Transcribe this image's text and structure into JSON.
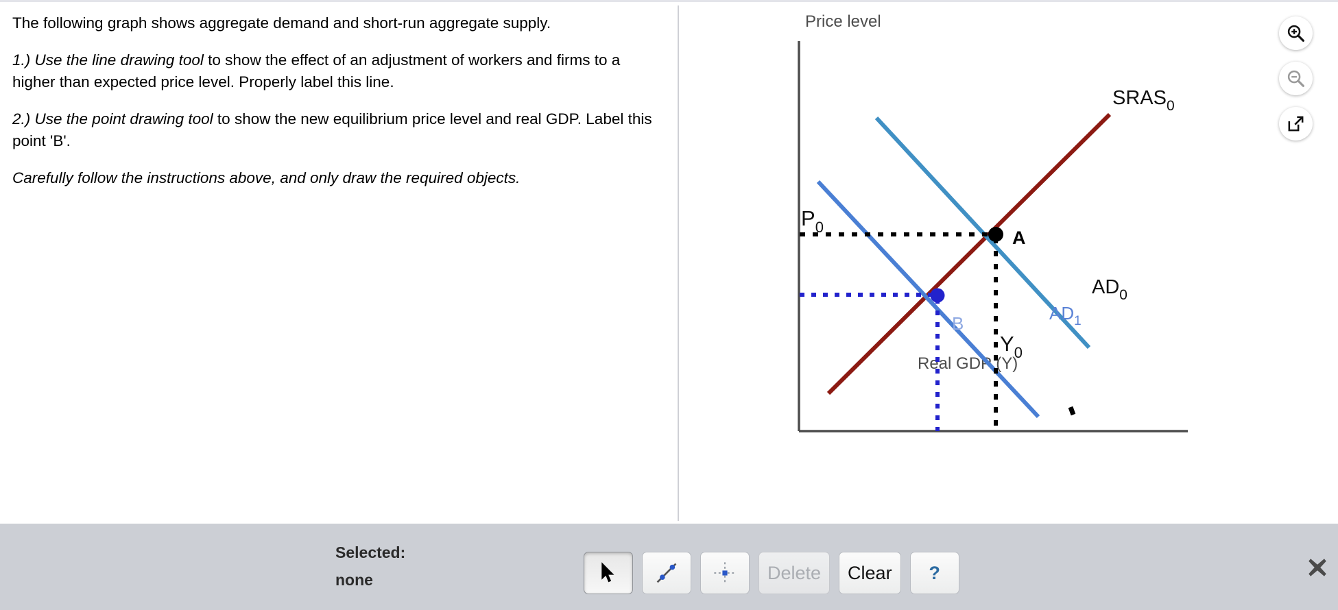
{
  "instructions": {
    "intro": "The following graph shows aggregate demand and short-run aggregate supply.",
    "step1_emph": "1.) Use the line drawing tool",
    "step1_rest": " to show the effect of an adjustment of workers and firms to a higher than expected price level. Properly label this line.",
    "step2_emph": "2.) Use the point drawing tool",
    "step2_rest": " to show the new equilibrium price level and real GDP. Label this point 'B'.",
    "closing": "Carefully follow the instructions above, and only draw the required objects."
  },
  "graph": {
    "y_axis_title": "Price level",
    "x_axis_title": "Real GDP (Y)",
    "axis_color": "#4d4d4d",
    "labels": {
      "sras0": "SRAS",
      "sras0_sub": "0",
      "ad0": "AD",
      "ad0_sub": "0",
      "ad1": "AD",
      "ad1_sub": "1",
      "p0": "P",
      "p0_sub": "0",
      "y0": "Y",
      "y0_sub": "0",
      "point_a": "A",
      "point_b": "B"
    },
    "colors": {
      "sras": "#8c1a12",
      "ad0": "#4090c4",
      "ad1": "#4a7fd4",
      "point_a": "#000000",
      "point_b": "#2222cc",
      "guide_a": "#000000",
      "guide_b": "#2222cc",
      "label_ad1": "#5a82d6",
      "label_b": "#7e9fe0"
    }
  },
  "chart_data": {
    "type": "line",
    "title": "",
    "xlabel": "Real GDP (Y)",
    "ylabel": "Price level",
    "grid": false,
    "legend": "inline-curve-labels",
    "series": [
      {
        "name": "SRAS0",
        "color": "#8c1a12",
        "points": [
          [
            0.055,
            0.175
          ],
          [
            0.855,
            0.805
          ]
        ],
        "label": "SRAS0"
      },
      {
        "name": "AD0",
        "color": "#4090c4",
        "points": [
          [
            0.2,
            0.805
          ],
          [
            0.795,
            0.28
          ]
        ],
        "label": "AD0"
      },
      {
        "name": "AD1",
        "color": "#4a7fd4",
        "points": [
          [
            0.05,
            0.64
          ],
          [
            0.655,
            0.105
          ]
        ],
        "label": "AD1"
      }
    ],
    "points": [
      {
        "name": "A",
        "x": 0.505,
        "y": 0.497,
        "color": "#000000",
        "label": "A"
      },
      {
        "name": "B",
        "x": 0.355,
        "y": 0.338,
        "color": "#2222cc",
        "label": "B"
      }
    ],
    "reference_lines": [
      {
        "name": "P0",
        "axis": "y",
        "value": 0.497,
        "style": "dotted",
        "color": "#000000",
        "label": "P0"
      },
      {
        "name": "Y0",
        "axis": "x",
        "value": 0.505,
        "style": "dotted",
        "color": "#000000",
        "label": "Y0"
      },
      {
        "name": "PB",
        "axis": "y",
        "value": 0.338,
        "style": "dotted",
        "color": "#2222cc",
        "label": ""
      },
      {
        "name": "YB",
        "axis": "x",
        "value": 0.355,
        "style": "dotted",
        "color": "#2222cc",
        "label": ""
      }
    ]
  },
  "icon_rail": [
    {
      "name": "zoom-in-icon",
      "enabled": true
    },
    {
      "name": "zoom-out-icon",
      "enabled": false
    },
    {
      "name": "pop-out-icon",
      "enabled": true
    }
  ],
  "toolbar": {
    "selected_label": "Selected:",
    "selected_value": "none",
    "buttons": [
      {
        "name": "select-tool",
        "icon": "cursor-arrow-icon",
        "label": "",
        "state": "pressed"
      },
      {
        "name": "line-tool",
        "icon": "line-draw-icon",
        "label": "",
        "state": "normal"
      },
      {
        "name": "point-tool",
        "icon": "point-draw-icon",
        "label": "",
        "state": "normal"
      },
      {
        "name": "delete-button",
        "icon": "",
        "label": "Delete",
        "state": "disabled"
      },
      {
        "name": "clear-button",
        "icon": "",
        "label": "Clear",
        "state": "normal"
      },
      {
        "name": "help-button",
        "icon": "",
        "label": "?",
        "state": "normal"
      }
    ],
    "close_label": "✖"
  }
}
